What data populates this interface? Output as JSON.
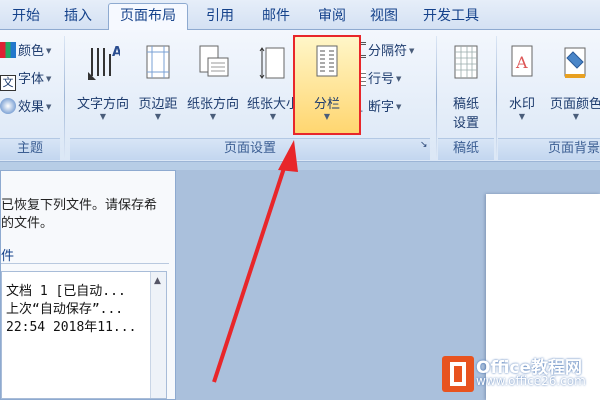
{
  "tabs": [
    {
      "label": "开始"
    },
    {
      "label": "插入"
    },
    {
      "label": "页面布局"
    },
    {
      "label": "引用"
    },
    {
      "label": "邮件"
    },
    {
      "label": "审阅"
    },
    {
      "label": "视图"
    },
    {
      "label": "开发工具"
    }
  ],
  "theme_group": {
    "colors": "颜色",
    "fonts": "字体",
    "effects": "效果",
    "label": "主题"
  },
  "page_setup": {
    "text_direction": "文字方向",
    "margins": "页边距",
    "orientation": "纸张方向",
    "size": "纸张大小",
    "columns": "分栏",
    "breaks": "分隔符",
    "line_numbers": "行号",
    "hyphenation": "断字",
    "label": "页面设置"
  },
  "manuscript": {
    "label_line1": "稿纸",
    "label_line2": "设置",
    "group_label": "稿纸"
  },
  "background": {
    "watermark": "水印",
    "page_color": "页面颜色",
    "group_label": "页面背景"
  },
  "recovery": {
    "message_line1": "已恢复下列文件。请保存希",
    "message_line2": "的文件。",
    "files_label": "件",
    "file_line1": "文档 1  [已自动...",
    "file_line2": "上次“自动保存”...",
    "file_line3": "22:54 2018年11..."
  },
  "watermark_logo": {
    "text": "Office教程网",
    "url": "www.office26.com"
  }
}
